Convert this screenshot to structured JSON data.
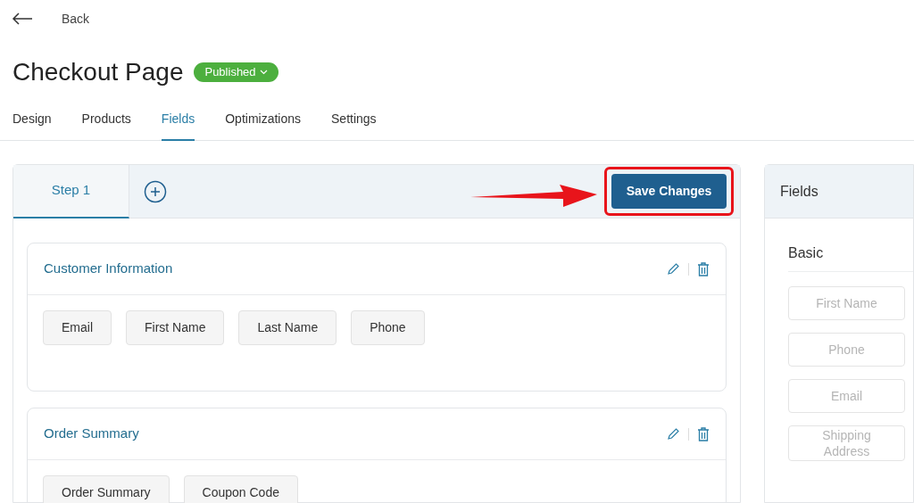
{
  "back": {
    "label": "Back"
  },
  "title": "Checkout Page",
  "status_badge": {
    "label": "Published"
  },
  "tabs": [
    {
      "label": "Design",
      "selected": false
    },
    {
      "label": "Products",
      "selected": false
    },
    {
      "label": "Fields",
      "selected": true
    },
    {
      "label": "Optimizations",
      "selected": false
    },
    {
      "label": "Settings",
      "selected": false
    }
  ],
  "steps": [
    {
      "label": "Step 1",
      "selected": true
    }
  ],
  "save_button": {
    "label": "Save Changes",
    "highlighted": true
  },
  "sections": [
    {
      "title": "Customer Information",
      "fields": [
        "Email",
        "First Name",
        "Last Name",
        "Phone"
      ]
    },
    {
      "title": "Order Summary",
      "fields": [
        "Order Summary",
        "Coupon Code"
      ]
    }
  ],
  "fields_panel": {
    "title": "Fields",
    "group": "Basic",
    "items": [
      "First Name",
      "Phone",
      "Email",
      "Shipping Address"
    ]
  }
}
